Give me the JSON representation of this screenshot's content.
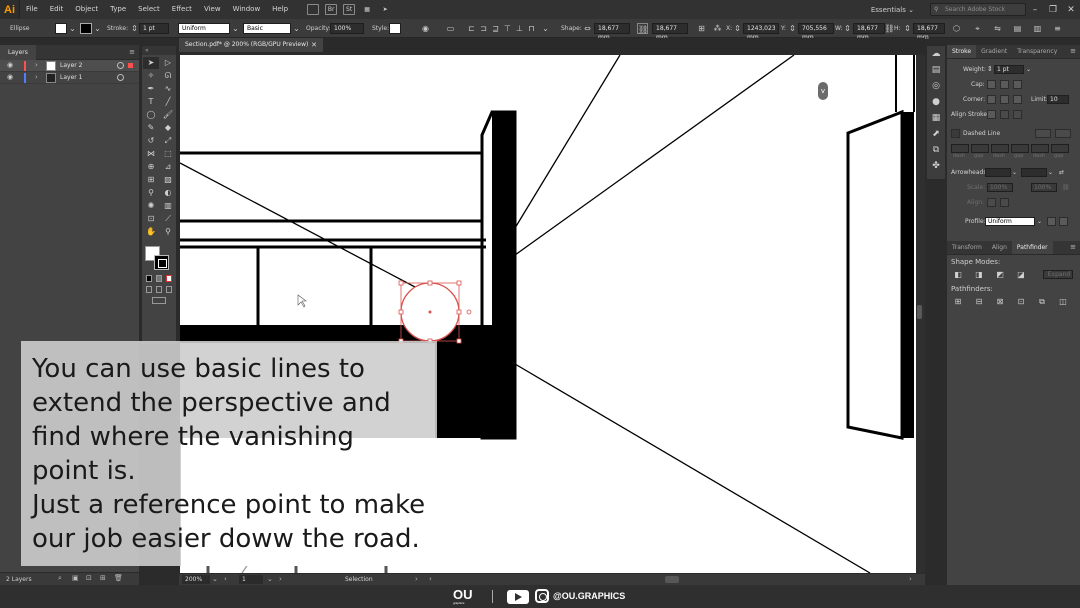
{
  "menubar": {
    "app_logo": "Ai",
    "items": [
      "File",
      "Edit",
      "Object",
      "Type",
      "Select",
      "Effect",
      "View",
      "Window",
      "Help"
    ],
    "bridge_icon": "Br",
    "stock_icon": "St",
    "workspace": "Essentials",
    "workspace_arrow": "⌄",
    "search_placeholder": "Search Adobe Stock",
    "window_controls": [
      "–",
      "❐",
      "✕"
    ]
  },
  "controlbar": {
    "object_type": "Ellipse",
    "stroke_label": "Stroke:",
    "stroke_weight": "1 pt",
    "variable_width": "Uniform",
    "brush": "Basic",
    "opacity_label": "Opacity:",
    "opacity_value": "100%",
    "style_label": "Style:",
    "shape_label": "Shape:",
    "shape_w": "18,677 mm",
    "shape_h": "18,677 mm",
    "x_label": "X:",
    "x_value": "1243,023 mm",
    "y_label": "Y:",
    "y_value": "705,556 mm",
    "w_label": "W:",
    "w_value": "18,677 mm",
    "h_label": "H:",
    "h_value": "18,677 mm"
  },
  "layers": {
    "tab": "Layers",
    "rows": [
      {
        "name": "Layer 2",
        "color": "#ff4f4f",
        "selected": true
      },
      {
        "name": "Layer 1",
        "color": "#4f7fff",
        "selected": false
      }
    ],
    "count": "2 Layers"
  },
  "document": {
    "tab_title": "Section.pdf* @ 200% (RGB/GPU Preview)",
    "tab_close": "✕",
    "badge": "v"
  },
  "statusbar": {
    "zoom": "200%",
    "artboard": "1",
    "tool": "Selection"
  },
  "stroke_panel": {
    "tabs": [
      "Stroke",
      "Gradient",
      "Transparency"
    ],
    "weight_label": "Weight:",
    "weight_value": "1 pt",
    "cap_label": "Cap:",
    "corner_label": "Corner:",
    "limit_label": "Limit:",
    "limit_value": "10",
    "align_label": "Align Stroke:",
    "dashed_label": "Dashed Line",
    "dash_labels": [
      "dash",
      "gap",
      "dash",
      "gap",
      "dash",
      "gap"
    ],
    "arrowheads_label": "Arrowheads:",
    "scale_label": "Scale:",
    "scale_values": [
      "100%",
      "100%"
    ],
    "align_arrow_label": "Align:",
    "profile_label": "Profile:",
    "profile_value": "Uniform"
  },
  "pathfinder_panel": {
    "tabs": [
      "Transform",
      "Align",
      "Pathfinder"
    ],
    "shape_modes_label": "Shape Modes:",
    "expand_label": "Expand",
    "pathfinders_label": "Pathfinders:"
  },
  "caption": {
    "text": "You can use basic lines to\nextend the perspective and\nfind where the vanishing\npoint is.\nJust a reference point to make\nour job easier doww the road."
  },
  "brand": {
    "logo": "OU",
    "logo_sub": "graphics",
    "handle": "@OU.GRAPHICS"
  },
  "icons": {
    "tools": [
      "selection-icon",
      "direct-selection-icon",
      "magic-wand-icon",
      "lasso-icon",
      "pen-icon",
      "curvature-icon",
      "type-icon",
      "line-icon",
      "ellipse-icon",
      "paintbrush-icon",
      "shaper-icon",
      "eraser-icon",
      "rotate-icon",
      "scale-icon",
      "width-icon",
      "free-transform-icon",
      "shape-builder-icon",
      "perspective-icon",
      "mesh-icon",
      "gradient-icon",
      "eyedropper-icon",
      "blend-icon",
      "symbol-sprayer-icon",
      "graph-icon",
      "artboard-icon",
      "slice-icon",
      "hand-icon",
      "zoom-icon"
    ]
  },
  "colors": {
    "accent": "#ff9a00",
    "selection": "#d9534f"
  }
}
